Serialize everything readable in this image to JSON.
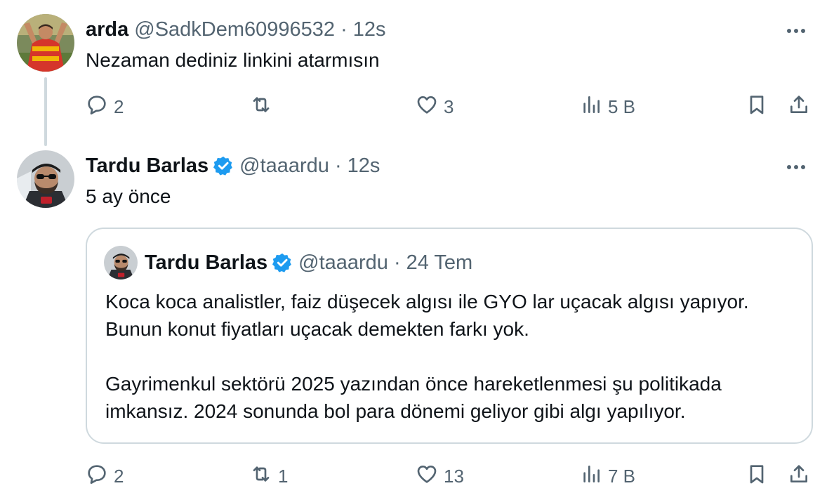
{
  "tweets": [
    {
      "name": "arda",
      "handle": "@SadkDem60996532",
      "separator": "·",
      "time": "12s",
      "text": "Nezaman dediniz linkini atarmısın",
      "actions": {
        "replies": "2",
        "retweets": "",
        "likes": "3",
        "views": "5 B"
      }
    },
    {
      "name": "Tardu Barlas",
      "handle": "@taaardu",
      "separator": "·",
      "time": "12s",
      "text": "5 ay önce",
      "quote": {
        "name": "Tardu Barlas",
        "handle": "@taaardu",
        "separator": "·",
        "time": "24 Tem",
        "paragraphs": [
          "Koca koca analistler, faiz düşecek algısı ile GYO lar uçacak algısı yapıyor. Bunun konut fiyatları uçacak demekten farkı yok.",
          "Gayrimenkul sektörü 2025 yazından önce hareketlenmesi şu politikada imkansız. 2024 sonunda bol para dönemi geliyor gibi algı yapılıyor."
        ]
      },
      "actions": {
        "replies": "2",
        "retweets": "1",
        "likes": "13",
        "views": "7 B"
      }
    }
  ],
  "icons": {
    "reply": "reply-icon",
    "retweet": "retweet-icon",
    "like": "heart-icon",
    "views": "views-icon",
    "bookmark": "bookmark-icon",
    "share": "share-icon",
    "more": "more-icon",
    "verified": "verified-icon"
  },
  "colors": {
    "text": "#0f1419",
    "secondary": "#536471",
    "border": "#cfd9de",
    "verified": "#1d9bf0"
  }
}
